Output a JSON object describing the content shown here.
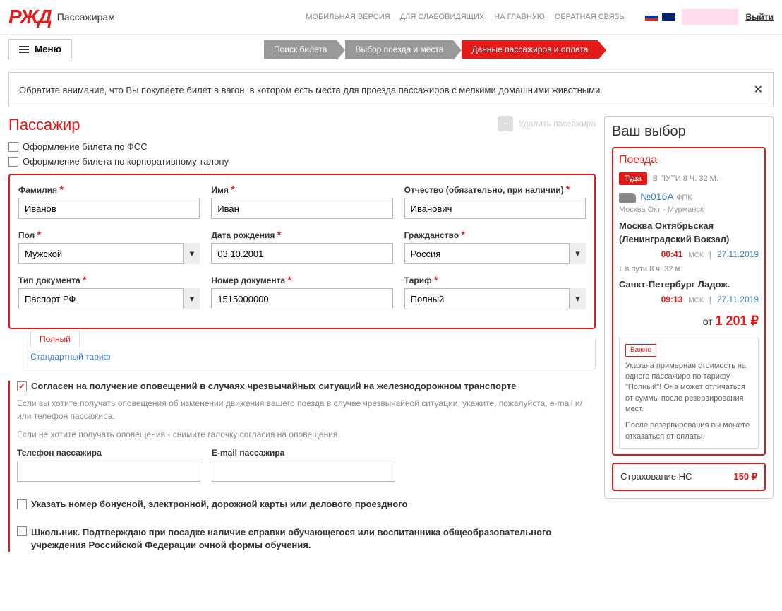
{
  "header": {
    "logo_sub": "Пассажирам",
    "top_links": [
      "МОБИЛЬНАЯ ВЕРСИЯ",
      "ДЛЯ СЛАБОВИДЯЩИХ",
      "НА ГЛАВНУЮ",
      "ОБРАТНАЯ СВЯЗЬ"
    ],
    "logout": "Выйти",
    "menu_label": "Меню"
  },
  "steps": [
    "Поиск билета",
    "Выбор поезда и места",
    "Данные пассажиров и оплата"
  ],
  "notice": "Обратите внимание, что Вы покупаете билет в вагон, в котором есть места для проезда пассажиров с мелкими домашними животными.",
  "passenger": {
    "title": "Пассажир",
    "delete_label": "Удалить пассажира",
    "fss_label": "Оформление билета по ФСС",
    "corp_label": "Оформление билета по корпоративному талону",
    "fields": {
      "surname": {
        "label": "Фамилия",
        "value": "Иванов"
      },
      "name": {
        "label": "Имя",
        "value": "Иван"
      },
      "patronymic": {
        "label": "Отчество (обязательно, при наличии)",
        "value": "Иванович"
      },
      "gender": {
        "label": "Пол",
        "value": "Мужской"
      },
      "birthdate": {
        "label": "Дата рождения",
        "value": "03.10.2001"
      },
      "citizenship": {
        "label": "Гражданство",
        "value": "Россия"
      },
      "doc_type": {
        "label": "Тип документа",
        "value": "Паспорт РФ"
      },
      "doc_number": {
        "label": "Номер документа",
        "value": "1515000000"
      },
      "tariff": {
        "label": "Тариф",
        "value": "Полный"
      }
    },
    "tariff_tab": "Полный",
    "tariff_standard": "Стандартный тариф",
    "consent": "Согласен на получение оповещений в случаях чрезвычайных ситуаций на железнодорожном транспорте",
    "hint1": "Если вы хотите получать оповещения об изменении движения вашего поезда в случае чрезвычайной ситуации, укажите, пожалуйста, e-mail и/или телефон пассажира.",
    "hint2": "Если не хотите получать оповещения - снимите галочку согласия на оповещения.",
    "phone_label": "Телефон пассажира",
    "email_label": "E-mail пассажира",
    "bonus_label": "Указать номер бонусной, электронной, дорожной карты или делового проездного",
    "school_label": "Школьник. Подтверждаю при посадке наличие справки обучающегося или воспитанника общеобразовательного учреждения Российской Федерации очной формы обучения."
  },
  "sidebar": {
    "choice_title": "Ваш выбор",
    "trains_title": "Поезда",
    "direction": "Туда",
    "duration_text": "В ПУТИ 8 Ч. 32 М.",
    "train_number": "№016А",
    "carrier": "ФПК",
    "route": "Москва Окт - Мурманск",
    "station_from": "Москва Октябрьская (Ленинградский Вокзал)",
    "time_from": "00:41",
    "tz": "МСК",
    "date_from": "27.11.2019",
    "travel": "в пути  8 ч. 32 м.",
    "station_to": "Санкт-Петербург Ладож.",
    "time_to": "09:13",
    "date_to": "27.11.2019",
    "price_prefix": "от",
    "price": "1 201 ₽",
    "important_label": "Важно",
    "important_text1": "Указана примерная стоимость на одного пассажира по тарифу \"Полный\"! Она может отличаться от суммы после резервирования мест.",
    "important_text2": "После резервирования вы можете отказаться от оплаты.",
    "insurance_label": "Страхование НС",
    "insurance_price": "150 ₽"
  }
}
